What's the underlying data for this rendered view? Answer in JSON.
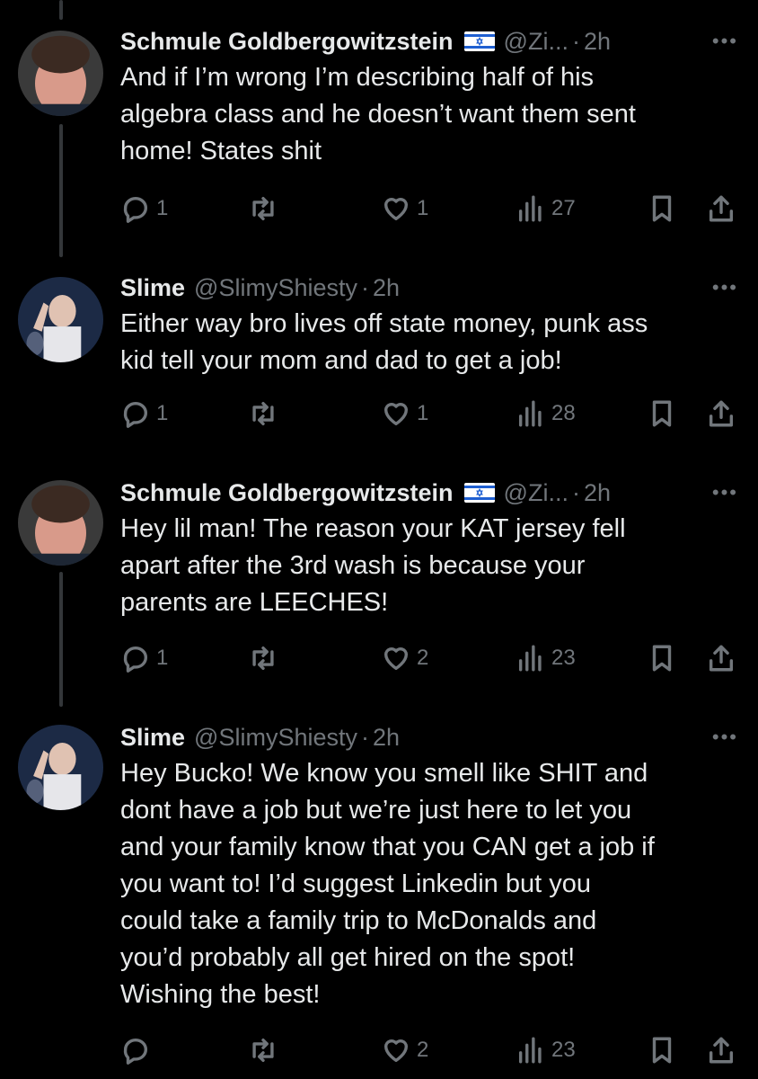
{
  "tweets": [
    {
      "name": "Schmule Goldbergowitzstein",
      "has_flag": true,
      "handle": "@Zi...",
      "time": "2h",
      "text": "And if I’m wrong I’m describing half of his\nalgebra class and he doesn’t want them sent\nhome! States shit",
      "replies": "1",
      "retweets": "",
      "likes": "1",
      "views": "27"
    },
    {
      "name": "Slime",
      "has_flag": false,
      "handle": "@SlimyShiesty",
      "time": "2h",
      "text": "Either way bro lives off state money, punk ass\nkid tell your mom and dad to get a job!",
      "replies": "1",
      "retweets": "",
      "likes": "1",
      "views": "28"
    },
    {
      "name": "Schmule Goldbergowitzstein",
      "has_flag": true,
      "handle": "@Zi...",
      "time": "2h",
      "text": "Hey lil man! The reason your KAT jersey fell\napart after the 3rd wash is because your\nparents are LEECHES!",
      "replies": "1",
      "retweets": "",
      "likes": "2",
      "views": "23"
    },
    {
      "name": "Slime",
      "has_flag": false,
      "handle": "@SlimyShiesty",
      "time": "2h",
      "text": "Hey Bucko! We know you smell like SHIT and\ndont have a job but we’re just here to let you\nand your family know that you CAN get a job if\nyou want to! I’d suggest Linkedin but you\ncould take a family trip to McDonalds and\nyou’d probably all get hired on the spot!\nWishing the best!",
      "replies": "",
      "retweets": "",
      "likes": "2",
      "views": "23"
    }
  ],
  "ui": {
    "dot": "·",
    "more": "•••"
  },
  "colors": {
    "background": "#000000",
    "text": "#e7e9ea",
    "secondary": "#71767b",
    "thread_line": "#333639"
  }
}
